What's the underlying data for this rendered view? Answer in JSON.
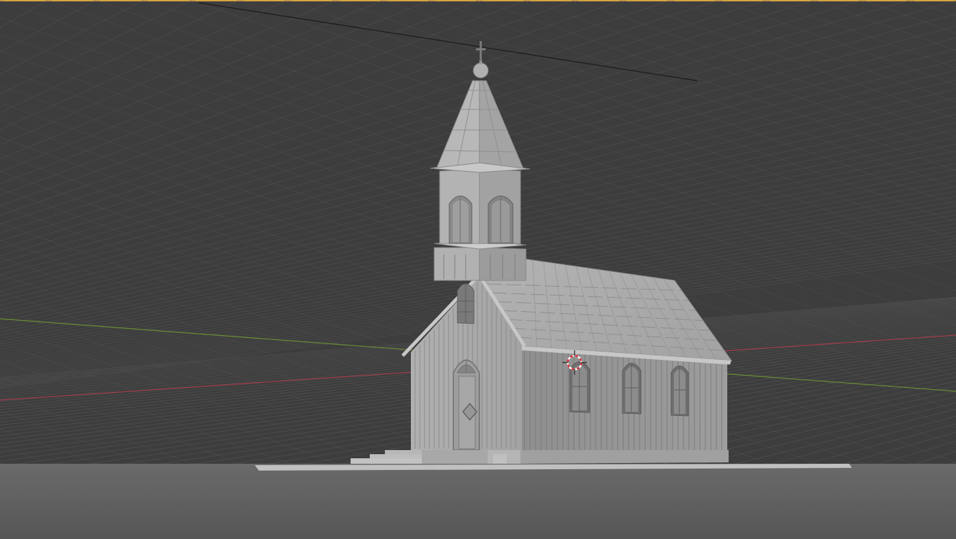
{
  "viewport": {
    "mode": "3d-viewport-solid-shading",
    "background_color": "#3d3d3d",
    "active_border_color": "#d9a441",
    "grid_color": "#575757",
    "floor_color": "#5e5e5e",
    "model_color": "#a9a9a9",
    "x_axis_color": "#a33d4d",
    "y_axis_color": "#6c8f34"
  },
  "scene": {
    "object": "church-model",
    "gizmo_icon": "3d-cursor-icon"
  }
}
